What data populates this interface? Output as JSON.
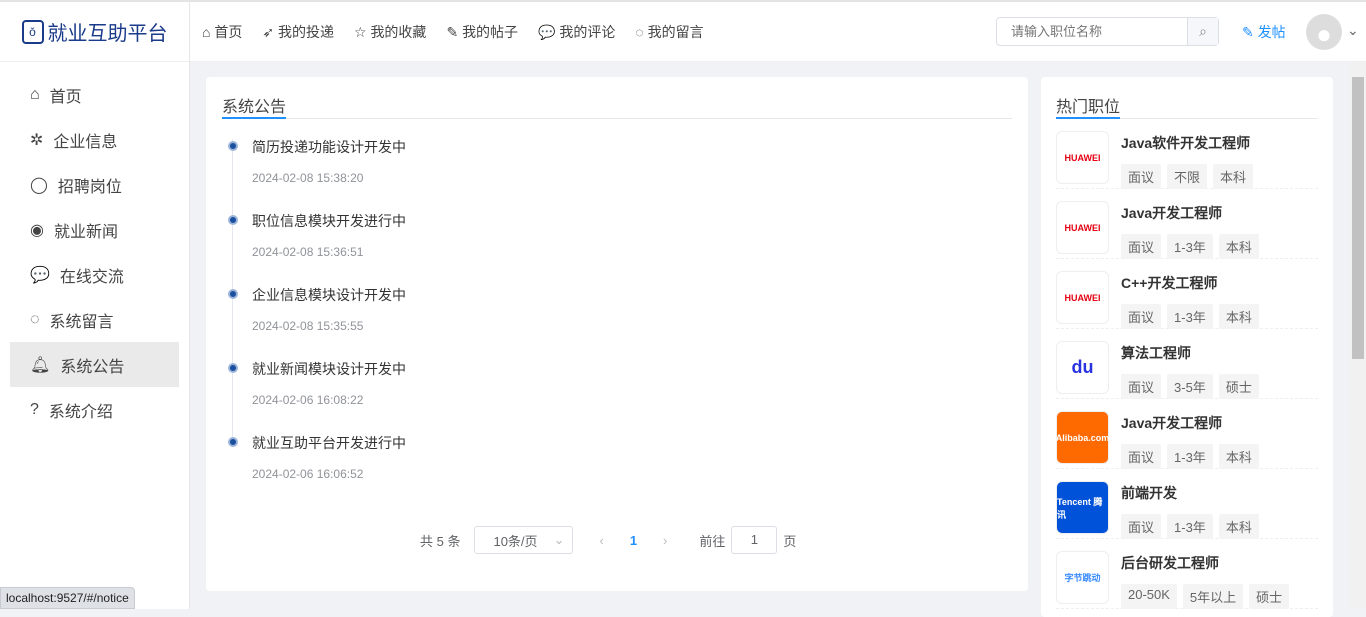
{
  "header": {
    "logo": "就业互助平台",
    "nav": [
      "首页",
      "我的投递",
      "我的收藏",
      "我的帖子",
      "我的评论",
      "我的留言"
    ],
    "search_placeholder": "请输入职位名称",
    "post": "发帖"
  },
  "sidebar": {
    "items": [
      "首页",
      "企业信息",
      "招聘岗位",
      "就业新闻",
      "在线交流",
      "系统留言",
      "系统公告",
      "系统介绍"
    ],
    "active": 6
  },
  "notice": {
    "title": "系统公告",
    "items": [
      {
        "title": "简历投递功能设计开发中",
        "date": "2024-02-08 15:38:20"
      },
      {
        "title": "职位信息模块开发进行中",
        "date": "2024-02-08 15:36:51"
      },
      {
        "title": "企业信息模块设计开发中",
        "date": "2024-02-08 15:35:55"
      },
      {
        "title": "就业新闻模块设计开发中",
        "date": "2024-02-06 16:08:22"
      },
      {
        "title": "就业互助平台开发进行中",
        "date": "2024-02-06 16:06:52"
      }
    ],
    "pagination": {
      "total": "共 5 条",
      "size": "10条/页",
      "page": "1",
      "goto": "前往",
      "goto_value": "1",
      "unit": "页"
    }
  },
  "hot": {
    "title": "热门职位",
    "jobs": [
      {
        "name": "Java软件开发工程师",
        "company": "HUAWEI",
        "tags": [
          "面议",
          "不限",
          "本科"
        ]
      },
      {
        "name": "Java开发工程师",
        "company": "HUAWEI",
        "tags": [
          "面议",
          "1-3年",
          "本科"
        ]
      },
      {
        "name": "C++开发工程师",
        "company": "HUAWEI",
        "tags": [
          "面议",
          "1-3年",
          "本科"
        ]
      },
      {
        "name": "算法工程师",
        "company": "du",
        "tags": [
          "面议",
          "3-5年",
          "硕士"
        ]
      },
      {
        "name": "Java开发工程师",
        "company": "Alibaba.com",
        "tags": [
          "面议",
          "1-3年",
          "本科"
        ]
      },
      {
        "name": "前端开发",
        "company": "Tencent 腾讯",
        "tags": [
          "面议",
          "1-3年",
          "本科"
        ]
      },
      {
        "name": "后台研发工程师",
        "company": "字节跳动",
        "tags": [
          "20-50K",
          "5年以上",
          "硕士"
        ]
      }
    ]
  },
  "status_url": "localhost:9527/#/notice"
}
